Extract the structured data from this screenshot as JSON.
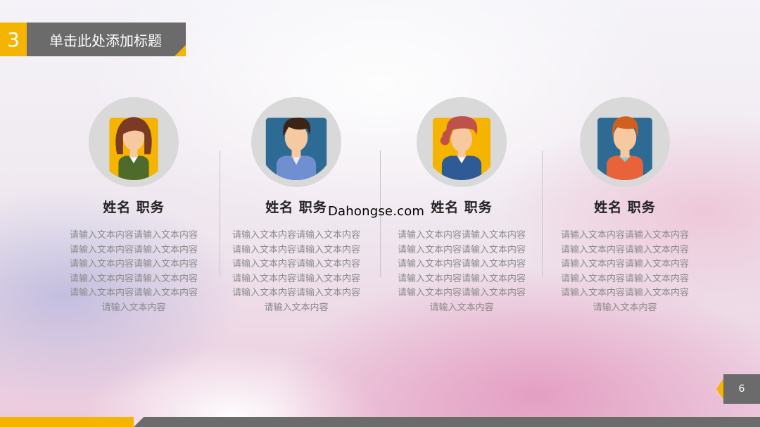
{
  "slide": {
    "number": "3",
    "title": "单击此处添加标题",
    "page": "6"
  },
  "watermark": "Dahongse.com",
  "people": [
    {
      "name": "姓名  职务",
      "avatar": "woman-avatar-icon",
      "lines": [
        "请输入文本内容请输入文本内容",
        "请输入文本内容请输入文本内容",
        "请输入文本内容请输入文本内容",
        "请输入文本内容请输入文本内容",
        "请输入文本内容请输入文本内容",
        "请输入文本内容"
      ]
    },
    {
      "name": "姓名  职务",
      "avatar": "man-avatar-icon",
      "lines": [
        "请输入文本内容请输入文本内容",
        "请输入文本内容请输入文本内容",
        "请输入文本内容请输入文本内容",
        "请输入文本内容请输入文本内容",
        "请输入文本内容请输入文本内容",
        "请输入文本内容"
      ]
    },
    {
      "name": "姓名  职务",
      "avatar": "woman-red-hair-avatar-icon",
      "lines": [
        "请输入文本内容请输入文本内容",
        "请输入文本内容请输入文本内容",
        "请输入文本内容请输入文本内容",
        "请输入文本内容请输入文本内容",
        "请输入文本内容请输入文本内容",
        "请输入文本内容"
      ]
    },
    {
      "name": "姓名  职务",
      "avatar": "man-orange-hair-avatar-icon",
      "lines": [
        "请输入文本内容请输入文本内容",
        "请输入文本内容请输入文本内容",
        "请输入文本内容请输入文本内容",
        "请输入文本内容请输入文本内容",
        "请输入文本内容请输入文本内容",
        "请输入文本内容"
      ]
    }
  ],
  "colors": {
    "accent": "#f4b400",
    "bar_gray": "#6b6b6b",
    "text_gray": "#8a8a8a"
  }
}
